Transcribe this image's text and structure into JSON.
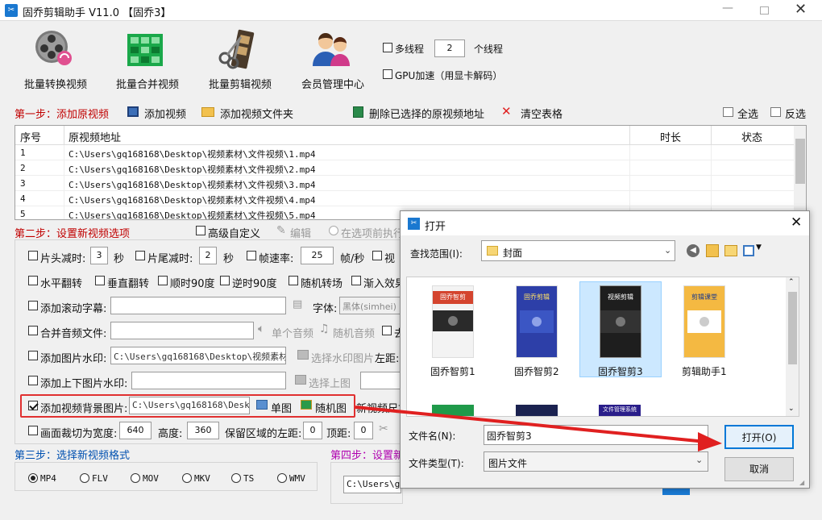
{
  "window": {
    "title": "固乔剪辑助手 V11.0 【固乔3】"
  },
  "toolbar": {
    "convert": "批量转换视频",
    "merge": "批量合并视频",
    "clip": "批量剪辑视频",
    "member": "会员管理中心",
    "multithread_label": "多线程",
    "thread_count": "2",
    "thread_unit": "个线程",
    "gpu_label": "GPU加速（用显卡解码）"
  },
  "step1": {
    "title": "第一步：添加原视频",
    "add_video": "添加视频",
    "add_folder": "添加视频文件夹",
    "delete_selected": "删除已选择的原视频地址",
    "clear_table": "清空表格",
    "select_all": "全选",
    "invert": "反选"
  },
  "table": {
    "headers": [
      "序号",
      "原视频地址",
      "时长",
      "状态"
    ],
    "rows": [
      {
        "index": "1",
        "path": "C:\\Users\\gq168168\\Desktop\\视频素材\\文件视频\\1.mp4"
      },
      {
        "index": "2",
        "path": "C:\\Users\\gq168168\\Desktop\\视频素材\\文件视频\\2.mp4"
      },
      {
        "index": "3",
        "path": "C:\\Users\\gq168168\\Desktop\\视频素材\\文件视频\\3.mp4"
      },
      {
        "index": "4",
        "path": "C:\\Users\\gq168168\\Desktop\\视频素材\\文件视频\\4.mp4"
      },
      {
        "index": "5",
        "path": "C:\\Users\\gq168168\\Desktop\\视频素材\\文件视频\\5.mp4"
      }
    ]
  },
  "step2": {
    "title": "第二步：设置新视频选项",
    "advanced": "高级自定义",
    "edit": "编辑",
    "run_before": "在选项前执行",
    "head_cut": "片头减时:",
    "head_value": "3",
    "sec": "秒",
    "tail_cut": "片尾减时:",
    "tail_value": "2",
    "sec2": "秒",
    "frame_rate": "帧速率:",
    "frame_value": "25",
    "fps": "帧/秒",
    "video_partial": "视",
    "hflip": "水平翻转",
    "vflip": "垂直翻转",
    "cw90": "顺时90度",
    "ccw90": "逆时90度",
    "random_transition": "随机转场",
    "fade_partial": "渐入效果",
    "subtitle": "添加滚动字幕:",
    "font_label": "字体:",
    "font_value": "黑体(simhei)",
    "merge_audio": "合并音频文件:",
    "single_audio": "单个音频",
    "random_audio": "随机音频",
    "remove_partial": "去",
    "image_watermark": "添加图片水印:",
    "image_watermark_path": "C:\\Users\\gq168168\\Desktop\\视频素材\\文",
    "select_watermark": "选择水印图片",
    "left_distance": "左距:",
    "top_bottom_watermark": "添加上下图片水印:",
    "select_top": "选择上图",
    "bg_image": "添加视频背景图片:",
    "bg_path": "C:\\Users\\gq168168\\Desktop",
    "single_image": "单图",
    "random_image": "随机图",
    "new_size_partial": "新视频尺寸",
    "crop_width": "画面裁切为宽度:",
    "crop_width_value": "640",
    "height_label": "高度:",
    "height_value": "360",
    "keep_left": "保留区域的左距:",
    "keep_left_value": "0",
    "top_label": "顶距:",
    "top_value": "0"
  },
  "step3": {
    "title": "第三步：选择新视频格式",
    "formats": [
      "MP4",
      "FLV",
      "MOV",
      "MKV",
      "TS",
      "WMV"
    ],
    "selected": "MP4"
  },
  "step4": {
    "title": "第四步：设置新",
    "path_partial": "C:\\Users\\gq"
  },
  "dialog": {
    "title": "打开",
    "look_in_label": "查找范围(I):",
    "look_in_value": "封面",
    "files": [
      {
        "name": "固乔智剪1",
        "thumb_top_text": "固乔智剪"
      },
      {
        "name": "固乔智剪2",
        "thumb_top_text": "固乔剪辑"
      },
      {
        "name": "固乔智剪3",
        "thumb_top_text": "视频剪辑"
      },
      {
        "name": "剪辑助手1",
        "thumb_top_text": "剪辑课堂"
      }
    ],
    "second_row_thumb_text": "文件管理系统",
    "filename_label": "文件名(N):",
    "filename_value": "固乔智剪3",
    "filetype_label": "文件类型(T):",
    "filetype_value": "图片文件",
    "open_button": "打开(O)",
    "cancel_button": "取消"
  },
  "colors": {
    "accent": "#0078d7",
    "red": "#c00000",
    "purple": "#b000b0",
    "blue": "#0050b0",
    "highlight": "#e03030"
  }
}
